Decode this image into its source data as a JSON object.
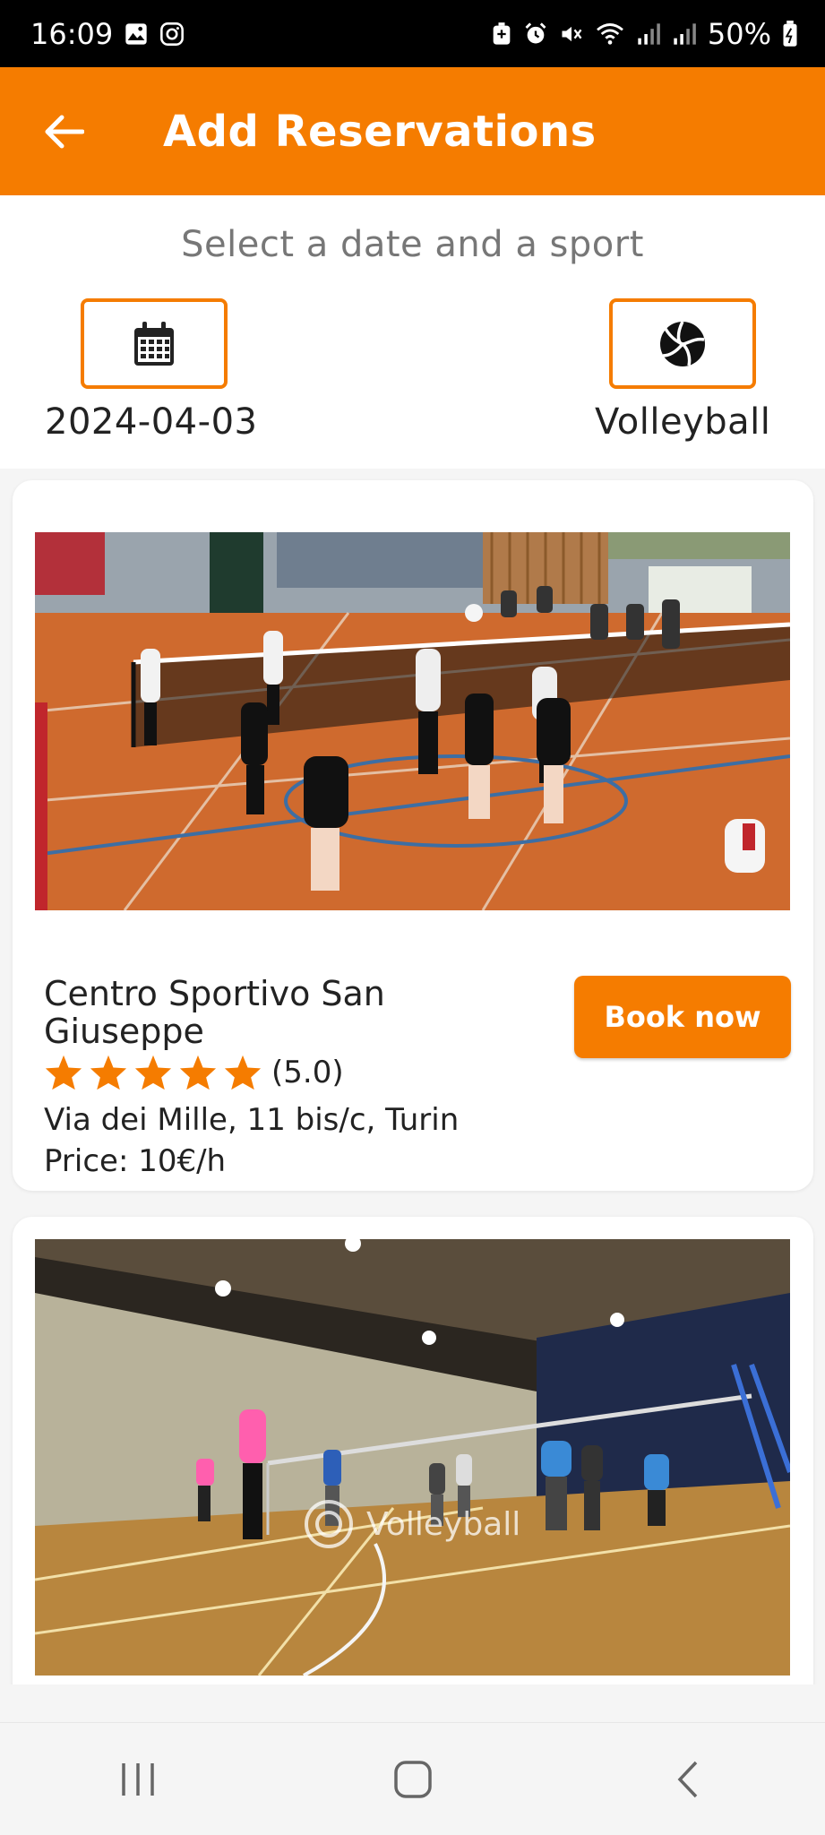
{
  "status": {
    "time": "16:09",
    "battery": "50%"
  },
  "appbar": {
    "title": "Add Reservations"
  },
  "selector": {
    "prompt": "Select a date and a sport",
    "date_value": "2024-04-03",
    "sport_value": "Volleyball"
  },
  "venues": [
    {
      "name": "Centro Sportivo  San Giuseppe",
      "rating_stars": 5,
      "rating_text": "(5.0)",
      "address": "Via dei Mille, 11 bis/c, Turin",
      "price": "Price: 10€/h",
      "book_label": "Book now"
    },
    {
      "watermark": "Volleyball"
    }
  ],
  "colors": {
    "accent": "#f57c00",
    "status_bar": "#000000"
  },
  "icons": {
    "back": "arrow-left",
    "date": "calendar",
    "sport": "volleyball"
  }
}
